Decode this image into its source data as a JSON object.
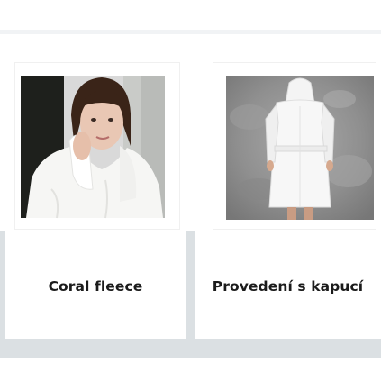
{
  "products": [
    {
      "caption": "Coral fleece",
      "image": "woman-in-white-bathrobe-photo"
    },
    {
      "caption": "Provedení s kapucí",
      "image": "hooded-bathrobe-back-photo"
    }
  ],
  "colors": {
    "panel": "#dbe0e3",
    "card": "#ffffff",
    "text": "#1b1b1b"
  }
}
